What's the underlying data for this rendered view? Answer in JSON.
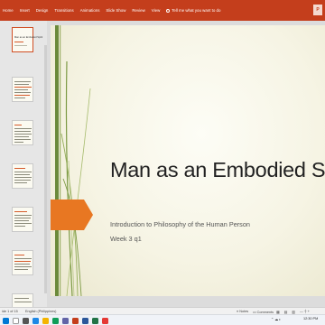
{
  "ribbon": {
    "tabs": [
      "Home",
      "Insert",
      "Design",
      "Transitions",
      "Animations",
      "Slide Show",
      "Review",
      "View"
    ],
    "tell_me": "Tell me what you want to do",
    "account_initial": "P"
  },
  "thumbnails": {
    "numbers": [
      "",
      "",
      "",
      "",
      "",
      "",
      ""
    ],
    "first_heading": "Man as an Embodied Spirit"
  },
  "slide": {
    "title": "Man as an Embodied Spirit",
    "subtitle_line1": "Introduction to Philosophy of the Human Person",
    "subtitle_line2": "Week 3 q1"
  },
  "status": {
    "slide_counter": "ide 1 of 15",
    "language": "English (Philippines)",
    "notes": "Notes",
    "comments": "Comments"
  },
  "taskbar": {
    "clock": "12:30 PM"
  },
  "colors": {
    "ribbon": "#c43e1c",
    "accent_orange": "#e87722",
    "accent_green": "#6b8a3a"
  }
}
